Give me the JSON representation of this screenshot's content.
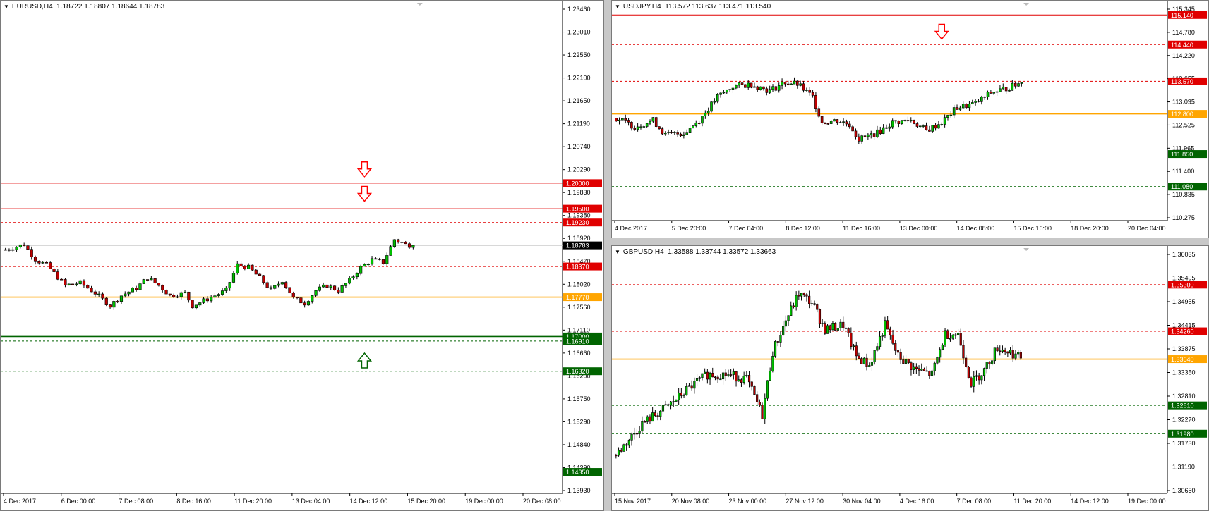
{
  "charts": {
    "eurusd": {
      "header": {
        "symbol": "EURUSD,H4",
        "ohlc": "1.18722 1.18807 1.18644 1.18783"
      },
      "price_ticks": [
        "1.23460",
        "1.23010",
        "1.22550",
        "1.22100",
        "1.21650",
        "1.21190",
        "1.20740",
        "1.20290",
        "1.19830",
        "1.19380",
        "1.18920",
        "1.18470",
        "1.18020",
        "1.17560",
        "1.17110",
        "1.16660",
        "1.16200",
        "1.15750",
        "1.15290",
        "1.14840",
        "1.14390",
        "1.13930"
      ],
      "time_labels": [
        "4 Dec 2017",
        "6 Dec 00:00",
        "7 Dec 08:00",
        "8 Dec 16:00",
        "11 Dec 20:00",
        "13 Dec 04:00",
        "14 Dec 12:00",
        "15 Dec 20:00",
        "19 Dec 00:00",
        "20 Dec 08:00"
      ],
      "levels": [
        {
          "price": "1.20000",
          "color": "#e00000",
          "style": "solid"
        },
        {
          "price": "1.19500",
          "color": "#e00000",
          "style": "solid"
        },
        {
          "price": "1.19230",
          "color": "#e00000",
          "style": "dash"
        },
        {
          "price": "1.18783",
          "color": "#000000",
          "style": "current"
        },
        {
          "price": "1.18370",
          "color": "#e00000",
          "style": "dash"
        },
        {
          "price": "1.17770",
          "color": "#ffa500",
          "style": "solid"
        },
        {
          "price": "1.17000",
          "color": "#006400",
          "style": "solid"
        },
        {
          "price": "1.16910",
          "color": "#006400",
          "style": "dash"
        },
        {
          "price": "1.16320",
          "color": "#006400",
          "style": "dash"
        },
        {
          "price": "1.14350",
          "color": "#006400",
          "style": "dash"
        }
      ],
      "arrows": [
        {
          "dir": "down",
          "bar": 96,
          "price": 1.2025
        },
        {
          "dir": "down",
          "bar": 96,
          "price": 1.1977
        },
        {
          "dir": "up",
          "bar": 96,
          "price": 1.1655
        }
      ]
    },
    "usdjpy": {
      "header": {
        "symbol": "USDJPY,H4",
        "ohlc": "113.572 113.637 113.471 113.540"
      },
      "price_ticks": [
        "115.345",
        "114.780",
        "114.220",
        "113.655",
        "113.095",
        "112.525",
        "111.965",
        "111.400",
        "110.835",
        "110.275"
      ],
      "time_labels": [
        "4 Dec 2017",
        "5 Dec 20:00",
        "7 Dec 04:00",
        "8 Dec 12:00",
        "11 Dec 16:00",
        "13 Dec 00:00",
        "14 Dec 08:00",
        "15 Dec 16:00",
        "18 Dec 20:00",
        "20 Dec 04:00"
      ],
      "levels": [
        {
          "price": "115.140",
          "color": "#e00000",
          "style": "solid"
        },
        {
          "price": "114.440",
          "color": "#e00000",
          "style": "dash"
        },
        {
          "price": "113.570",
          "color": "#e00000",
          "style": "dash"
        },
        {
          "price": "112.800",
          "color": "#ffa500",
          "style": "solid"
        },
        {
          "price": "111.850",
          "color": "#006400",
          "style": "dash"
        },
        {
          "price": "111.080",
          "color": "#006400",
          "style": "dash"
        }
      ],
      "arrows": [
        {
          "dir": "down",
          "bar": 106,
          "price": 114.72
        }
      ]
    },
    "gbpusd": {
      "header": {
        "symbol": "GBPUSD,H4",
        "ohlc": "1.33588 1.33744 1.33572 1.33663"
      },
      "price_ticks": [
        "1.36035",
        "1.35495",
        "1.34955",
        "1.34415",
        "1.33875",
        "1.33350",
        "1.32810",
        "1.32270",
        "1.31730",
        "1.31190",
        "1.30650"
      ],
      "time_labels": [
        "15 Nov 2017",
        "20 Nov 08:00",
        "23 Nov 00:00",
        "27 Nov 12:00",
        "30 Nov 04:00",
        "4 Dec 16:00",
        "7 Dec 08:00",
        "11 Dec 20:00",
        "14 Dec 12:00",
        "19 Dec 00:00"
      ],
      "levels": [
        {
          "price": "1.35300",
          "color": "#e00000",
          "style": "dash"
        },
        {
          "price": "1.34260",
          "color": "#e00000",
          "style": "dash"
        },
        {
          "price": "1.33640",
          "color": "#ffa500",
          "style": "solid"
        },
        {
          "price": "1.32610",
          "color": "#006400",
          "style": "dash"
        },
        {
          "price": "1.31980",
          "color": "#006400",
          "style": "dash"
        }
      ],
      "arrows": []
    }
  },
  "chart_data": [
    {
      "type": "candlestick",
      "symbol": "EURUSD,H4",
      "ylim": [
        1.1393,
        1.2346
      ],
      "x_ticks": [
        "4 Dec 2017",
        "6 Dec 00:00",
        "7 Dec 08:00",
        "8 Dec 16:00",
        "11 Dec 20:00",
        "13 Dec 04:00",
        "14 Dec 12:00",
        "15 Dec 20:00",
        "19 Dec 00:00",
        "20 Dec 08:00"
      ],
      "close_path": [
        [
          0,
          1.187
        ],
        [
          5,
          1.188
        ],
        [
          8,
          1.185
        ],
        [
          11,
          1.184
        ],
        [
          16,
          1.18
        ],
        [
          20,
          1.1805
        ],
        [
          24,
          1.1785
        ],
        [
          28,
          1.176
        ],
        [
          31,
          1.178
        ],
        [
          35,
          1.1795
        ],
        [
          38,
          1.1815
        ],
        [
          41,
          1.18
        ],
        [
          44,
          1.178
        ],
        [
          48,
          1.1785
        ],
        [
          50,
          1.176
        ],
        [
          53,
          1.177
        ],
        [
          56,
          1.178
        ],
        [
          59,
          1.179
        ],
        [
          62,
          1.184
        ],
        [
          65,
          1.1835
        ],
        [
          68,
          1.1815
        ],
        [
          71,
          1.179
        ],
        [
          74,
          1.181
        ],
        [
          77,
          1.1775
        ],
        [
          80,
          1.1765
        ],
        [
          83,
          1.179
        ],
        [
          86,
          1.18
        ],
        [
          89,
          1.179
        ],
        [
          92,
          1.181
        ],
        [
          95,
          1.1835
        ],
        [
          98,
          1.185
        ],
        [
          101,
          1.1845
        ],
        [
          104,
          1.189
        ],
        [
          107,
          1.188
        ],
        [
          109,
          1.1878
        ]
      ],
      "last": 1.18783
    },
    {
      "type": "candlestick",
      "symbol": "USDJPY,H4",
      "ylim": [
        110.275,
        115.345
      ],
      "x_ticks": [
        "4 Dec 2017",
        "5 Dec 20:00",
        "7 Dec 04:00",
        "8 Dec 12:00",
        "11 Dec 16:00",
        "13 Dec 00:00",
        "14 Dec 08:00",
        "15 Dec 16:00",
        "18 Dec 20:00",
        "20 Dec 04:00"
      ],
      "close_path": [
        [
          0,
          112.7
        ],
        [
          6,
          112.5
        ],
        [
          12,
          112.65
        ],
        [
          16,
          112.3
        ],
        [
          22,
          112.35
        ],
        [
          27,
          112.65
        ],
        [
          33,
          113.2
        ],
        [
          38,
          113.45
        ],
        [
          44,
          113.5
        ],
        [
          50,
          113.35
        ],
        [
          55,
          113.55
        ],
        [
          59,
          113.5
        ],
        [
          64,
          113.2
        ],
        [
          67,
          112.6
        ],
        [
          72,
          112.65
        ],
        [
          76,
          112.55
        ],
        [
          79,
          112.2
        ],
        [
          85,
          112.35
        ],
        [
          90,
          112.6
        ],
        [
          96,
          112.65
        ],
        [
          101,
          112.4
        ],
        [
          106,
          112.6
        ],
        [
          111,
          112.95
        ],
        [
          117,
          113.05
        ],
        [
          122,
          113.3
        ],
        [
          127,
          113.4
        ],
        [
          132,
          113.54
        ]
      ],
      "last": 113.54
    },
    {
      "type": "candlestick",
      "symbol": "GBPUSD,H4",
      "ylim": [
        1.3065,
        1.36035
      ],
      "x_ticks": [
        "15 Nov 2017",
        "20 Nov 08:00",
        "23 Nov 00:00",
        "27 Nov 12:00",
        "30 Nov 04:00",
        "4 Dec 16:00",
        "7 Dec 08:00",
        "11 Dec 20:00",
        "14 Dec 12:00",
        "19 Dec 00:00"
      ],
      "close_path": [
        [
          0,
          1.315
        ],
        [
          10,
          1.322
        ],
        [
          20,
          1.326
        ],
        [
          28,
          1.33
        ],
        [
          35,
          1.333
        ],
        [
          42,
          1.333
        ],
        [
          50,
          1.332
        ],
        [
          56,
          1.324
        ],
        [
          60,
          1.338
        ],
        [
          65,
          1.345
        ],
        [
          70,
          1.351
        ],
        [
          75,
          1.349
        ],
        [
          80,
          1.343
        ],
        [
          87,
          1.344
        ],
        [
          92,
          1.337
        ],
        [
          97,
          1.335
        ],
        [
          103,
          1.344
        ],
        [
          108,
          1.337
        ],
        [
          115,
          1.334
        ],
        [
          121,
          1.333
        ],
        [
          126,
          1.342
        ],
        [
          131,
          1.342
        ],
        [
          136,
          1.331
        ],
        [
          141,
          1.334
        ],
        [
          146,
          1.339
        ],
        [
          151,
          1.338
        ],
        [
          155,
          1.3366
        ]
      ],
      "last": 1.33663
    }
  ]
}
